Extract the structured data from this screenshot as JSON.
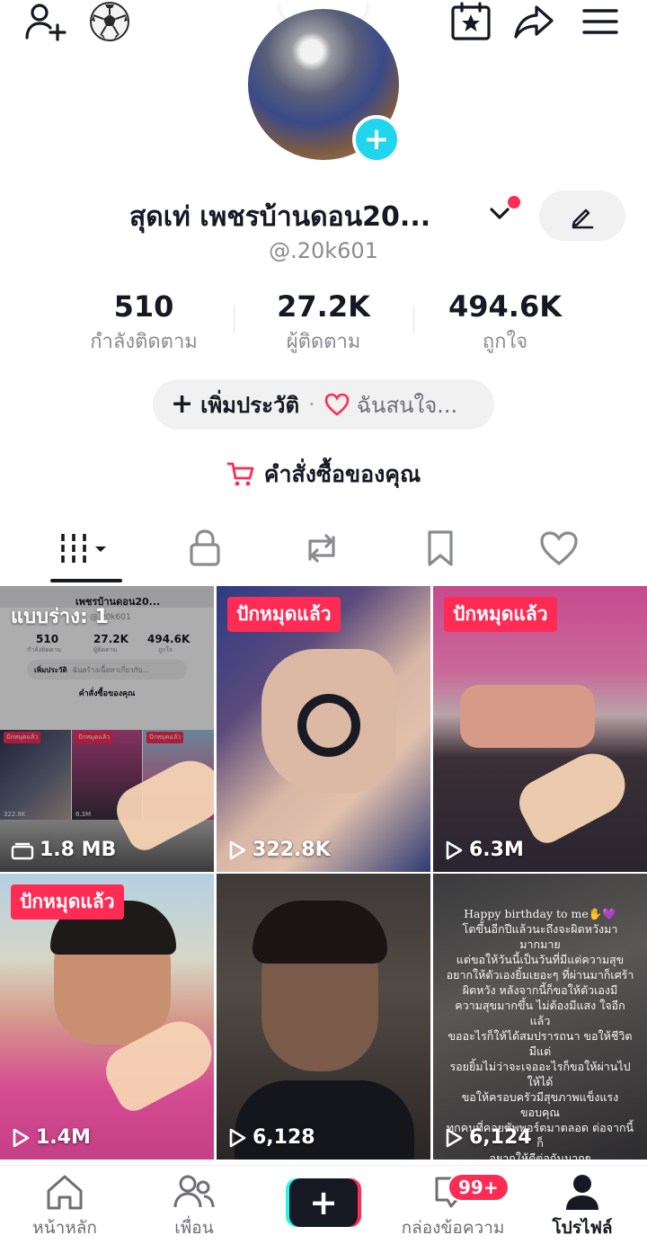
{
  "header": {
    "add_friend_icon": "person-plus-icon",
    "sport_icon": "soccer-ball-icon",
    "calendar_icon": "calendar-star-icon",
    "share_icon": "share-arrow-icon",
    "menu_icon": "hamburger-menu-icon"
  },
  "profile": {
    "display_name": "สุดเท่   เพชรบ้านดอน20...",
    "handle": "@.20k601",
    "stats": [
      {
        "value": "510",
        "label": "กำลังติดตาม"
      },
      {
        "value": "27.2K",
        "label": "ผู้ติดตาม"
      },
      {
        "value": "494.6K",
        "label": "ถูกใจ"
      }
    ],
    "bio_add": "เพิ่มประวัติ",
    "bio_interest": "ฉันสนใจ...",
    "orders": "คำสั่งซื้อของคุณ"
  },
  "tabs": [
    "videos-grid",
    "private-lock",
    "reposts",
    "favorites",
    "liked"
  ],
  "videos": [
    {
      "badge": "",
      "draft_label": "แบบร่าง: 1",
      "count": "1.8 MB",
      "type": "draft"
    },
    {
      "badge": "ปักหมุดแล้ว",
      "count": "322.8K",
      "type": "play"
    },
    {
      "badge": "ปักหมุดแล้ว",
      "count": "6.3M",
      "type": "play"
    },
    {
      "badge": "ปักหมุดแล้ว",
      "count": "1.4M",
      "type": "play"
    },
    {
      "badge": "",
      "count": "6,128",
      "type": "play"
    },
    {
      "badge": "",
      "count": "6,124",
      "type": "play"
    }
  ],
  "draft_preview": {
    "name": "เพชรบ้านดอน20...",
    "handle": "@.20k601",
    "stats": [
      "510",
      "27.2K",
      "494.6K"
    ],
    "stat_labels": [
      "กำลังติดตาม",
      "ผู้ติดตาม",
      "ถูกใจ"
    ],
    "bio_add": "เพิ่มประวัติ",
    "bio_interest": "ฉันสร้างเนื้อหาเกี่ยวกับ...",
    "orders": "คำสั่งซื้อของคุณ",
    "mini_badge_1": "ปักหมุดแล้ว",
    "mini_badge_2": "ปักหมุดแล้ว",
    "mini_badge_3": "ปักหมุดแล้ว",
    "mini_count_1": "322.8K",
    "mini_count_2": "6.3M"
  },
  "birthday_text": "Happy birthday to me✋💜\nโตขึ้นอีกปีแล้วนะถึงจะผิดหวังมามากมาย\nแต่ขอให้วันนี้เป็นวันที่มีแต่ความสุข\nอยากให้ตัวเองยิ้มเยอะๆ ที่ผ่านมาก็เศร้า\nผิดหวัง หลังจากนี้ก็ขอให้ตัวเองมี\nความสุขมากขึ้น ไม่ต้องมีแสง ใจอีกแล้ว\nขออะไรก็ให้ได้สมปรารถนา ขอให้ชีวิตมีแต่\nรอยยิ้มไม่ว่าจะเจออะไรก็ขอให้ผ่านไปให้ได้\nขอให้ครอบครัวมีสุขภาพแข็งแรงขอบคุณ\nทุกคนที่คอยซัพพอร์ตมาตลอด ต่อจากนี้ก็\nอยากให้ดีต่อกันมากๆ",
  "bottom_nav": {
    "home": "หน้าหลัก",
    "friends": "เพื่อน",
    "inbox": "กล่องข้อความ",
    "inbox_badge": "99+",
    "profile": "โปรไฟล์"
  },
  "colors": {
    "accent": "#fe2c55",
    "cyan": "#20d5ec",
    "text": "#161823",
    "muted": "#8a8b91"
  }
}
